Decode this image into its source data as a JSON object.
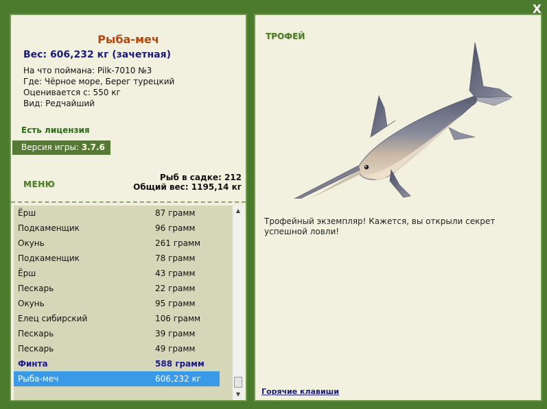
{
  "window": {
    "close_label": "X"
  },
  "fish": {
    "title": "Рыба-меч",
    "weight_line": "Вес: 606,232 кг (зачетная)",
    "caught_on": "На что поймана: Pilk-7010 №3",
    "location": "Где: Чёрное море, Берег турецкий",
    "valued_from": "Оценивается с: 550 кг",
    "rarity": "Вид: Редчайший"
  },
  "license": "Есть лицензия",
  "version": {
    "label": "Версия игры: ",
    "value": "3.7.6"
  },
  "menu_label": "МЕНЮ",
  "summary": {
    "count_line": "Рыб в садке: 212",
    "total_line": "Общий вес: 1195,14 кг"
  },
  "catch_list": [
    {
      "name": "Ёрш",
      "weight": "87 грамм",
      "state": "normal"
    },
    {
      "name": "Подкаменщик",
      "weight": "96 грамм",
      "state": "normal"
    },
    {
      "name": "Окунь",
      "weight": "261 грамм",
      "state": "normal"
    },
    {
      "name": "Подкаменщик",
      "weight": "78 грамм",
      "state": "normal"
    },
    {
      "name": "Ёрш",
      "weight": "43 грамм",
      "state": "normal"
    },
    {
      "name": "Пескарь",
      "weight": "22 грамм",
      "state": "normal"
    },
    {
      "name": "Окунь",
      "weight": "95 грамм",
      "state": "normal"
    },
    {
      "name": "Елец сибирский",
      "weight": "106 грамм",
      "state": "normal"
    },
    {
      "name": "Пескарь",
      "weight": "39 грамм",
      "state": "normal"
    },
    {
      "name": "Пескарь",
      "weight": "49 грамм",
      "state": "normal"
    },
    {
      "name": "Финта",
      "weight": "588 грамм",
      "state": "highlight"
    },
    {
      "name": "Рыба-меч",
      "weight": "606,232 кг",
      "state": "selected"
    }
  ],
  "trophy": {
    "label": "ТРОФЕЙ",
    "text": "Трофейный экземпляр! Кажется, вы открыли секрет успешной ловли!",
    "image_icon": "swordfish-image"
  },
  "hotkeys_label": "Горячие клавиши",
  "colors": {
    "frame": "#4c7b2e",
    "panel_bg": "#f2f1df",
    "title": "#b04a10",
    "weight": "#1a1a7a",
    "selected_row": "#3a9ae8",
    "list_bg": "#d6d6b8"
  }
}
